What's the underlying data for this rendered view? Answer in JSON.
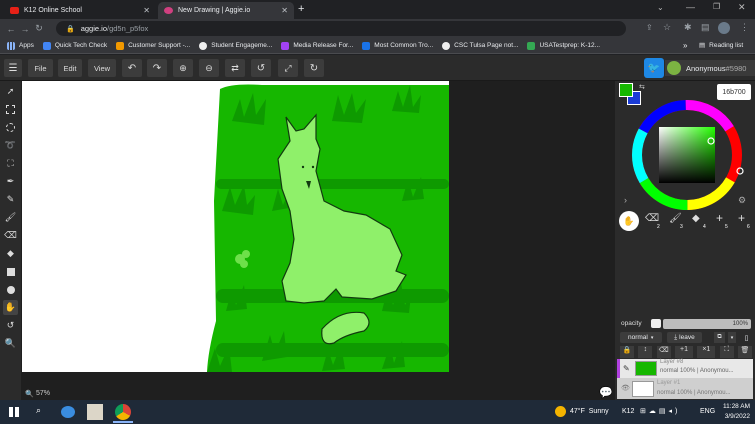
{
  "browser": {
    "tabs": [
      {
        "title": "K12 Online School",
        "active": false
      },
      {
        "title": "New Drawing | Aggie.io",
        "active": true
      }
    ],
    "new_tab": "+",
    "url_host": "aggie.io",
    "url_path": "/gd5n_p5fox",
    "reading_list": "Reading list",
    "bookmarks": [
      "Apps",
      "Quick Tech Check",
      "Customer Support -...",
      "Student Engageme...",
      "Media Release For...",
      "Most Common Tro...",
      "CSC Tulsa Page not...",
      "USATestprep: K-12..."
    ],
    "more": "»"
  },
  "toolbar": {
    "file": "File",
    "edit": "Edit",
    "view": "View"
  },
  "user": {
    "name": "Anonymous",
    "id": "#5980"
  },
  "color": {
    "hex": "16b700",
    "primary": "#16b700",
    "secondary": "#1a3bd6"
  },
  "brush_presets": [
    "1",
    "2",
    "3",
    "4",
    "5",
    "6"
  ],
  "layer_panel": {
    "opacity_label": "opacity",
    "opacity_value": "100%",
    "blend_mode": "normal",
    "leave_label": "leave",
    "layers": [
      {
        "name": "Layer #8",
        "info": "normal 100% | Anonymou..."
      },
      {
        "name": "Layer #1",
        "info": "normal 100% | Anonymou..."
      }
    ]
  },
  "status": {
    "zoom": "57%"
  },
  "taskbar": {
    "weather": "47°F  Sunny",
    "lang": "ENG",
    "time": "11:28 AM",
    "date": "3/9/2022",
    "k12": "K12"
  }
}
